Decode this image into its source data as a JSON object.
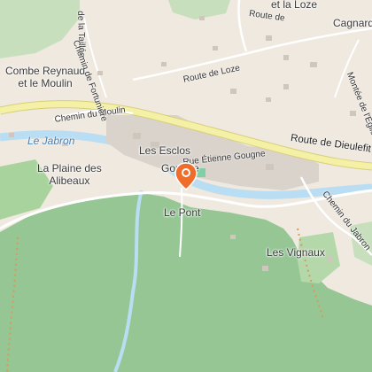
{
  "colors": {
    "land": "#efe9e0",
    "forest": "#95c694",
    "meadow": "#c5e0bb",
    "water": "#b9ddf2",
    "river_label": "#4a7fb0",
    "main_road": "#f4f0a6",
    "marker": "#f06c2a"
  },
  "places": {
    "combe_reynaud": "Combe Reynaud\net le Moulin",
    "et_la_loze": "et la Loze",
    "cagnard": "Cagnard",
    "la_plaine": "La Plaine des\nAlibeaux",
    "les_esclos": "Les Esclos",
    "gougne": "Gougne",
    "le_pont": "Le Pont",
    "les_vignaux": "Les Vignaux"
  },
  "roads": {
    "route_de_dieulefit": "Route de Dieulefit",
    "route_de_loze": "Route de Loze",
    "route_de_loze_top": "Route de",
    "chemin_du_moulin": "Chemin du Moulin",
    "rue_etienne_gougne": "Rue Étienne Gougne",
    "chemin_du_jabron": "Chemin du Jabron",
    "chemin_de_la_taillee": "de la Taillée",
    "chemin_de_fortuniere": "Chemin de Fortunière",
    "montee_de_leglise": "Montée de l'Église"
  },
  "waterways": {
    "le_jabron": "Le Jabron"
  },
  "marker": {
    "icon": "location-pin-icon"
  }
}
